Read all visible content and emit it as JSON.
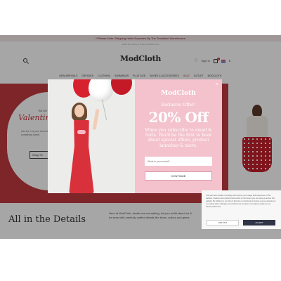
{
  "promo": {
    "text": "**Please Note: Shipping Holds Expected By The Transition Warehouses",
    "subtext": "Read all holiday & shipping details here"
  },
  "header": {
    "logo": "ModCloth",
    "sign_in": "Sign in",
    "bag_count": "0",
    "currency": "$",
    "search_icon": "search-icon",
    "heart_icon": "heart-icon",
    "bag_icon": "bag-icon"
  },
  "nav": {
    "items": [
      "NEW ARRIVALS",
      "DRESSES",
      "CLOTHING",
      "SWIMWEAR",
      "PLUS SIZE",
      "SHOES & ACCESSORIES",
      "SALE",
      "OUTLET",
      "MODCLOTH"
    ]
  },
  "hero": {
    "small": "BE MY",
    "title": "Valentine",
    "text": "Get set. Let your heart lead and find something sweet.",
    "button": "Shop Fe"
  },
  "lower": {
    "title": "All in the Details",
    "text": "Here at ModCloth, details are everything; let your outfit stand out & be seen with carefully crafted details like bows, collars and gems."
  },
  "modal": {
    "logo": "ModCloth",
    "exclusive": "Exclusive Offer!",
    "offer": "20% Off",
    "description": "When you subscribe to email & texts. You'll be the first to hear about special offers, product launches & more.",
    "email_placeholder": "What is your email?",
    "continue": "CONTINUE",
    "close": "×"
  },
  "cookie": {
    "text": "This site uses cookies to simplify and improve your usage and experience of this website. Cookies are small text files stored on the device you are using to access this website. By clicking on any link on this site or continuing to browse you are agreeing to our cookie policy. Manage your preferences and learn more about cookies in our Privacy Statement.",
    "opt_out": "OPT OUT",
    "accept": "ACCEPT"
  },
  "colors": {
    "brand_red": "#c13a40",
    "modal_pink": "#f3c2cc",
    "accept_dark": "#2f3547"
  }
}
